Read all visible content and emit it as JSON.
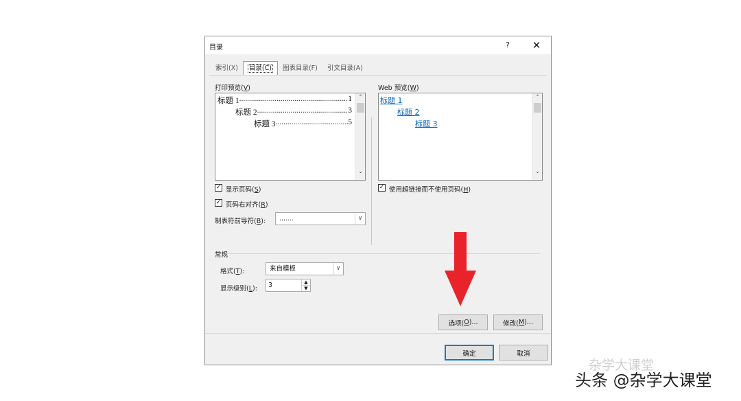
{
  "dialog": {
    "title": "目录",
    "help_label": "?",
    "close_label": "✕"
  },
  "tabs": [
    {
      "label": "索引(X)",
      "active": false
    },
    {
      "label": "目录(C)",
      "active": true
    },
    {
      "label": "图表目录(F)",
      "active": false
    },
    {
      "label": "引文目录(A)",
      "active": false
    }
  ],
  "print_preview": {
    "label": "打印预览(",
    "accel": "V",
    "label_end": ")",
    "rows": [
      {
        "text": "标题 1",
        "page": "1"
      },
      {
        "text": "标题 2",
        "page": "3"
      },
      {
        "text": "标题 3",
        "page": "5"
      }
    ]
  },
  "web_preview": {
    "label": "Web 预览(",
    "accel": "W",
    "label_end": ")",
    "links": [
      "标题 1",
      "标题 2",
      "标题 3"
    ]
  },
  "options": {
    "show_page_numbers": {
      "label": "显示页码(",
      "accel": "S",
      "label_end": ")",
      "checked": true
    },
    "right_align": {
      "label": "页码右对齐(",
      "accel": "R",
      "label_end": ")",
      "checked": true
    },
    "tab_leader": {
      "label": "制表符前导符(",
      "accel": "B",
      "label_end": "):",
      "value": "......."
    },
    "use_hyperlinks": {
      "label": "使用超链接而不使用页码(",
      "accel": "H",
      "label_end": ")",
      "checked": true
    }
  },
  "general": {
    "heading": "常规",
    "format": {
      "label": "格式(",
      "accel": "T",
      "label_end": "):",
      "value": "来自模板"
    },
    "levels": {
      "label": "显示级别(",
      "accel": "L",
      "label_end": "):",
      "value": "3"
    }
  },
  "buttons": {
    "options": "选项(",
    "options_accel": "O",
    "options_end": ")...",
    "modify": "修改(",
    "modify_accel": "M",
    "modify_end": ")...",
    "ok": "确定",
    "cancel": "取消"
  },
  "colors": {
    "link": "#0563c1",
    "arrow": "#e8242a",
    "focus": "#0078d7"
  },
  "watermark": {
    "ghost": "杂学大课堂",
    "text": "头条 @杂学大课堂"
  }
}
